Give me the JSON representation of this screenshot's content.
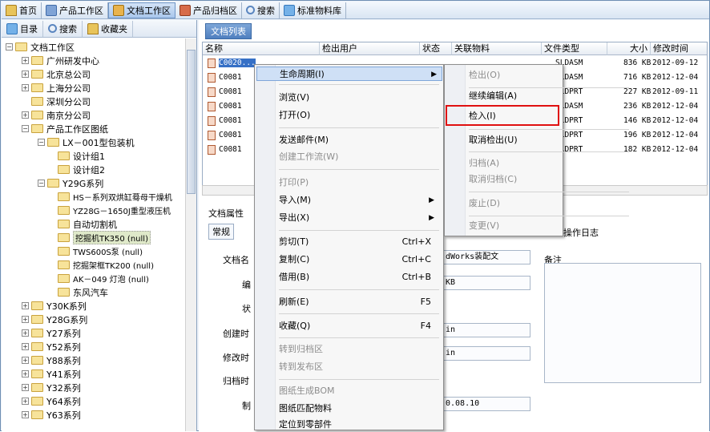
{
  "top_tabs": [
    {
      "label": "首页",
      "icon": "home-icon"
    },
    {
      "label": "产品工作区",
      "icon": "product-icon"
    },
    {
      "label": "文档工作区",
      "icon": "document-icon",
      "active": true
    },
    {
      "label": "产品归档区",
      "icon": "archive-icon"
    },
    {
      "label": "搜索",
      "icon": "search-icon"
    },
    {
      "label": "标准物料库",
      "icon": "library-icon"
    }
  ],
  "left_toolbar": {
    "catalog": "目录",
    "search": "搜索",
    "favorites": "收藏夹"
  },
  "tree": {
    "root": "文档工作区",
    "items": [
      "广州研发中心",
      "北京总公司",
      "上海分公司",
      "深圳分公司",
      "南京分公司",
      "产品工作区图纸",
      "LX－001型包装机",
      "设计组1",
      "设计组2",
      "Y29G系列",
      "HS－系列双烘缸蓦母干燥机",
      "YZ28G－1650J重型液压机",
      "自动切割机",
      "挖掘机TK350 (null)",
      "TWS600S泵 (null)",
      "挖掘架框TK200 (null)",
      "AK－049 灯泡 (null)",
      "东风汽车",
      "Y30K系列",
      "Y28G系列",
      "Y27系列",
      "Y52系列",
      "Y88系列",
      "Y41系列",
      "Y32系列",
      "Y64系列",
      "Y63系列"
    ]
  },
  "right_tab": "文档列表",
  "list": {
    "columns": [
      "名称",
      "检出用户",
      "状态",
      "关联物料",
      "文件类型",
      "大小",
      "修改时间"
    ],
    "rows": [
      {
        "name": "C0020...",
        "type": "SLDASM",
        "size": "836 KB",
        "time": "2012-09-12"
      },
      {
        "name": "C0081",
        "type": "SLDASM",
        "size": "716 KB",
        "time": "2012-12-04"
      },
      {
        "name": "C0081",
        "type": "SLDPRT",
        "size": "227 KB",
        "time": "2012-09-11"
      },
      {
        "name": "C0081",
        "type": "SLDASM",
        "size": "236 KB",
        "time": "2012-12-04"
      },
      {
        "name": "C0081",
        "type": "SLDPRT",
        "size": "146 KB",
        "time": "2012-12-04"
      },
      {
        "name": "C0081",
        "type": "SLDPRT",
        "size": "196 KB",
        "time": "2012-12-04"
      },
      {
        "name": "C0081",
        "type": "SLDPRT",
        "size": "182 KB",
        "time": "2012-12-04"
      }
    ]
  },
  "props": {
    "title": "文档属性",
    "tab": "常规",
    "log_tab": "操作日志",
    "labels": [
      "文档名",
      "编",
      "状",
      "创建时",
      "修改时",
      "归档时",
      "制"
    ],
    "values": {
      "file_type": "dWorks装配文",
      "size": "KB",
      "create": "in",
      "modify": "in",
      "made": "0.08.10"
    },
    "note_label": "备注"
  },
  "context_menu": [
    {
      "label": "生命周期(I)",
      "submenu": true,
      "highlight": true
    },
    {
      "label": "浏览(V)"
    },
    {
      "label": "打开(O)"
    },
    {
      "label": "发送邮件(M)"
    },
    {
      "label": "创建工作流(W)",
      "disabled": true
    },
    {
      "label": "打印(P)",
      "disabled": true
    },
    {
      "label": "导入(M)",
      "submenu": true
    },
    {
      "label": "导出(X)",
      "submenu": true
    },
    {
      "label": "剪切(T)",
      "shortcut": "Ctrl+X"
    },
    {
      "label": "复制(C)",
      "shortcut": "Ctrl+C"
    },
    {
      "label": "借用(B)",
      "shortcut": "Ctrl+B"
    },
    {
      "label": "刷新(E)",
      "shortcut": "F5"
    },
    {
      "label": "收藏(Q)",
      "shortcut": "F4"
    },
    {
      "label": "转到归档区",
      "disabled": true
    },
    {
      "label": "转到发布区",
      "disabled": true
    },
    {
      "label": "图纸生成BOM",
      "disabled": true
    },
    {
      "label": "图纸匹配物料"
    },
    {
      "label": "定位到零部件"
    }
  ],
  "submenu": [
    {
      "label": "检出(O)",
      "disabled": true
    },
    {
      "label": "继续编辑(A)"
    },
    {
      "label": "检入(I)",
      "boxed": true
    },
    {
      "label": "取消检出(U)"
    },
    {
      "label": "归档(A)",
      "disabled": true
    },
    {
      "label": "取消归档(C)",
      "disabled": true
    },
    {
      "label": "废止(D)",
      "disabled": true
    },
    {
      "label": "变更(V)",
      "disabled": true
    }
  ]
}
